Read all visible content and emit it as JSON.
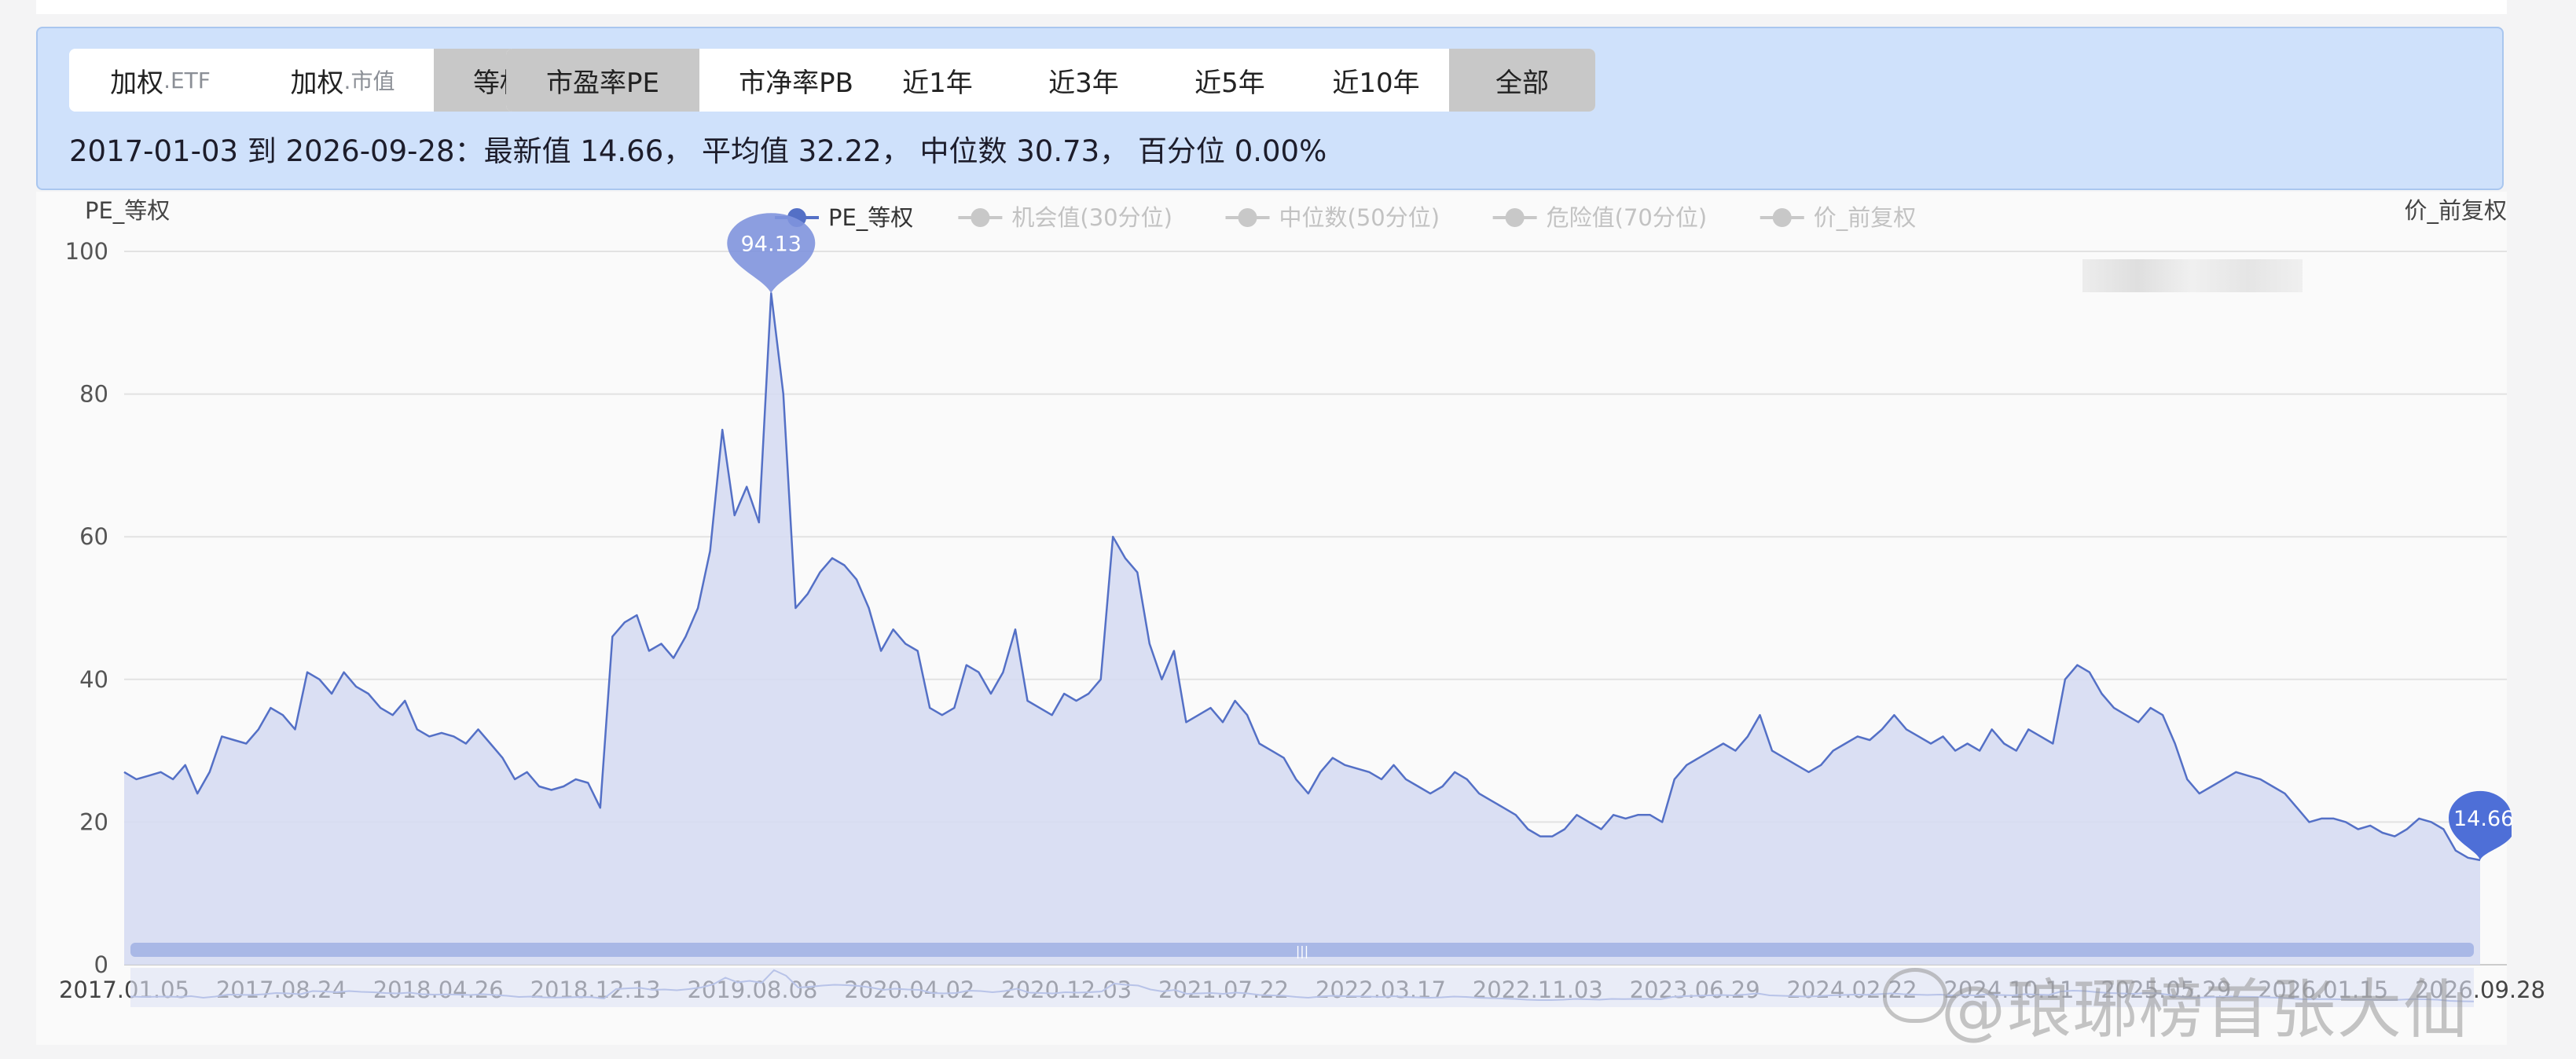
{
  "controls": {
    "weight_group": [
      {
        "label": "加权",
        "sub": ".ETF",
        "active": false
      },
      {
        "label": "加权",
        "sub": ".市值",
        "active": false
      },
      {
        "label": "等权",
        "sub": "",
        "active": true
      }
    ],
    "metric_group": [
      {
        "label": "市盈率PE",
        "active": true
      },
      {
        "label": "市净率PB",
        "active": false
      }
    ],
    "range_group": [
      {
        "label": "近1年",
        "active": false
      },
      {
        "label": "近3年",
        "active": false
      },
      {
        "label": "近5年",
        "active": false
      },
      {
        "label": "近10年",
        "active": false
      },
      {
        "label": "全部",
        "active": true
      }
    ]
  },
  "stats": {
    "period": "2017-01-03 到 2026-09-28：",
    "latest": "最新值 14.66，",
    "mean": "平均值 32.22，",
    "median": "中位数 30.73，",
    "percentile": "百分位 0.00%"
  },
  "watermark": "@琅琊榜首张大仙",
  "colors": {
    "line": "#5470c6",
    "area": "#d6dcf2",
    "panel": "#cfe1fb",
    "legend_inactive": "#c8c8c8"
  },
  "chart_data": {
    "type": "area",
    "ylabel": "PE_等权",
    "y2label": "价_前复权",
    "ylim": [
      0,
      100
    ],
    "yticks": [
      0,
      20,
      40,
      60,
      80,
      100
    ],
    "grid": true,
    "legend": [
      {
        "name": "PE_等权",
        "active": true
      },
      {
        "name": "机会值(30分位)",
        "active": false
      },
      {
        "name": "中位数(50分位)",
        "active": false
      },
      {
        "name": "危险值(70分位)",
        "active": false
      },
      {
        "name": "价_前复权",
        "active": false
      }
    ],
    "xticks": [
      "2017.01.05",
      "2017.08.24",
      "2018.04.26",
      "2018.12.13",
      "2019.08.08",
      "2020.04.02",
      "2020.12.03",
      "2021.07.22",
      "2022.03.17",
      "2022.11.03",
      "2023.06.29",
      "2024.02.22",
      "2024.10.11",
      "2025.05.29",
      "2026.01.15",
      "2026.09.28"
    ],
    "max_label": "94.13",
    "last_label": "14.66",
    "series": [
      {
        "name": "PE_等权",
        "values": [
          27.0,
          26.0,
          26.5,
          27.0,
          26.0,
          28.0,
          24.0,
          27.0,
          32.0,
          31.5,
          31.0,
          33.0,
          36.0,
          35.0,
          33.0,
          41.0,
          40.0,
          38.0,
          41.0,
          39.0,
          38.0,
          36.0,
          35.0,
          37.0,
          33.0,
          32.0,
          32.5,
          32.0,
          31.0,
          33.0,
          31.0,
          29.0,
          26.0,
          27.0,
          25.0,
          24.5,
          25.0,
          26.0,
          25.5,
          22.0,
          46.0,
          48.0,
          49.0,
          44.0,
          45.0,
          43.0,
          46.0,
          50.0,
          58.0,
          75.0,
          63.0,
          67.0,
          62.0,
          94.13,
          80.0,
          50.0,
          52.0,
          55.0,
          57.0,
          56.0,
          54.0,
          50.0,
          44.0,
          47.0,
          45.0,
          44.0,
          36.0,
          35.0,
          36.0,
          42.0,
          41.0,
          38.0,
          41.0,
          47.0,
          37.0,
          36.0,
          35.0,
          38.0,
          37.0,
          38.0,
          40.0,
          60.0,
          57.0,
          55.0,
          45.0,
          40.0,
          44.0,
          34.0,
          35.0,
          36.0,
          34.0,
          37.0,
          35.0,
          31.0,
          30.0,
          29.0,
          26.0,
          24.0,
          27.0,
          29.0,
          28.0,
          27.5,
          27.0,
          26.0,
          28.0,
          26.0,
          25.0,
          24.0,
          25.0,
          27.0,
          26.0,
          24.0,
          23.0,
          22.0,
          21.0,
          19.0,
          18.0,
          18.0,
          19.0,
          21.0,
          20.0,
          19.0,
          21.0,
          20.5,
          21.0,
          21.0,
          20.0,
          26.0,
          28.0,
          29.0,
          30.0,
          31.0,
          30.0,
          32.0,
          35.0,
          30.0,
          29.0,
          28.0,
          27.0,
          28.0,
          30.0,
          31.0,
          32.0,
          31.5,
          33.0,
          35.0,
          33.0,
          32.0,
          31.0,
          32.0,
          30.0,
          31.0,
          30.0,
          33.0,
          31.0,
          30.0,
          33.0,
          32.0,
          31.0,
          40.0,
          42.0,
          41.0,
          38.0,
          36.0,
          35.0,
          34.0,
          36.0,
          35.0,
          31.0,
          26.0,
          24.0,
          25.0,
          26.0,
          27.0,
          26.5,
          26.0,
          25.0,
          24.0,
          22.0,
          20.0,
          20.5,
          20.5,
          20.0,
          19.0,
          19.5,
          18.5,
          18.0,
          19.0,
          20.5,
          20.0,
          19.0,
          16.0,
          15.0,
          14.66
        ]
      }
    ]
  }
}
